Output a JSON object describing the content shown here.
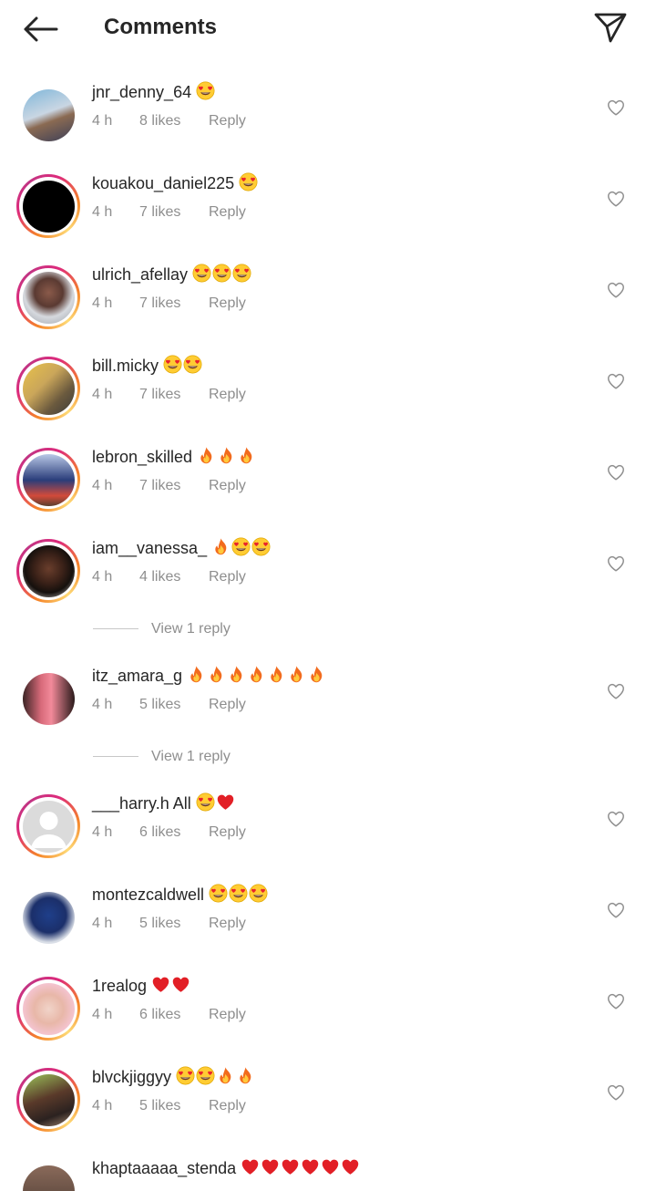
{
  "header": {
    "title": "Comments",
    "back_icon": "arrow-left-icon",
    "share_icon": "paper-plane-icon"
  },
  "colors": {
    "text_primary": "#262626",
    "text_secondary": "#8e8e8e",
    "story_ring": [
      "#f58529",
      "#dd2a7b",
      "#c13584",
      "#feda77"
    ],
    "reply_label": "Reply"
  },
  "comments": [
    {
      "username": "jnr_denny_64",
      "text": "",
      "emojis": [
        "heart-eyes"
      ],
      "time": "4 h",
      "likes": "8 likes",
      "reply": "Reply",
      "story_ring": false
    },
    {
      "username": "kouakou_daniel225",
      "text": "",
      "emojis": [
        "heart-eyes"
      ],
      "time": "4 h",
      "likes": "7 likes",
      "reply": "Reply",
      "story_ring": true
    },
    {
      "username": "ulrich_afellay",
      "text": "",
      "emojis": [
        "heart-eyes",
        "heart-eyes",
        "heart-eyes"
      ],
      "time": "4 h",
      "likes": "7 likes",
      "reply": "Reply",
      "story_ring": true
    },
    {
      "username": "bill.micky",
      "text": "",
      "emojis": [
        "heart-eyes",
        "heart-eyes"
      ],
      "time": "4 h",
      "likes": "7 likes",
      "reply": "Reply",
      "story_ring": true
    },
    {
      "username": "lebron_skilled",
      "text": "",
      "emojis": [
        "fire",
        "fire",
        "fire"
      ],
      "time": "4 h",
      "likes": "7 likes",
      "reply": "Reply",
      "story_ring": true
    },
    {
      "username": "iam__vanessa_",
      "text": "",
      "emojis": [
        "fire",
        "heart-eyes",
        "heart-eyes"
      ],
      "time": "4 h",
      "likes": "4 likes",
      "reply": "Reply",
      "story_ring": true,
      "view_replies": "View 1 reply"
    },
    {
      "username": "itz_amara_g",
      "text": "",
      "emojis": [
        "fire",
        "fire",
        "fire",
        "fire",
        "fire",
        "fire",
        "fire"
      ],
      "time": "4 h",
      "likes": "5 likes",
      "reply": "Reply",
      "story_ring": false,
      "view_replies": "View 1 reply"
    },
    {
      "username": "___harry.h",
      "text": "All",
      "emojis": [
        "heart-eyes",
        "red-heart"
      ],
      "time": "4 h",
      "likes": "6 likes",
      "reply": "Reply",
      "story_ring": true
    },
    {
      "username": "montezcaldwell",
      "text": "",
      "emojis": [
        "heart-eyes",
        "heart-eyes",
        "heart-eyes"
      ],
      "time": "4 h",
      "likes": "5 likes",
      "reply": "Reply",
      "story_ring": false
    },
    {
      "username": "1realog",
      "text": "",
      "emojis": [
        "red-heart",
        "red-heart"
      ],
      "time": "4 h",
      "likes": "6 likes",
      "reply": "Reply",
      "story_ring": true
    },
    {
      "username": "blvckjiggyy",
      "text": "",
      "emojis": [
        "heart-eyes",
        "heart-eyes",
        "fire",
        "fire"
      ],
      "time": "4 h",
      "likes": "5 likes",
      "reply": "Reply",
      "story_ring": true
    },
    {
      "username": "khaptaaaaa_stenda",
      "text": "",
      "emojis": [
        "red-heart",
        "red-heart",
        "red-heart",
        "red-heart",
        "red-heart",
        "red-heart"
      ],
      "time": "",
      "likes": "",
      "reply": "",
      "story_ring": false
    }
  ]
}
